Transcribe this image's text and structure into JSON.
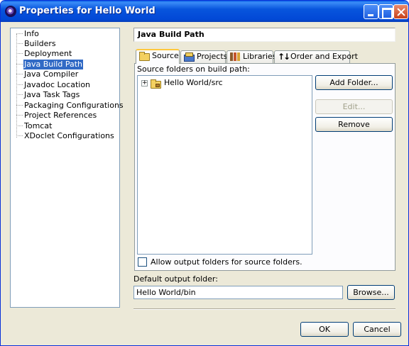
{
  "window": {
    "title": "Properties for Hello World"
  },
  "sidebar": {
    "items": [
      {
        "label": "Info",
        "selected": false
      },
      {
        "label": "Builders",
        "selected": false
      },
      {
        "label": "Deployment",
        "selected": false
      },
      {
        "label": "Java Build Path",
        "selected": true
      },
      {
        "label": "Java Compiler",
        "selected": false
      },
      {
        "label": "Javadoc Location",
        "selected": false
      },
      {
        "label": "Java Task Tags",
        "selected": false
      },
      {
        "label": "Packaging Configurations",
        "selected": false
      },
      {
        "label": "Project References",
        "selected": false
      },
      {
        "label": "Tomcat",
        "selected": false
      },
      {
        "label": "XDoclet Configurations",
        "selected": false
      }
    ]
  },
  "page": {
    "title": "Java Build Path",
    "tabs": [
      {
        "label": "Source",
        "icon": "source-folder-icon",
        "active": true
      },
      {
        "label": "Projects",
        "icon": "projects-icon",
        "active": false
      },
      {
        "label": "Libraries",
        "icon": "libraries-icon",
        "active": false
      },
      {
        "label": "Order and Export",
        "icon": "order-icon",
        "active": false
      }
    ],
    "source_label": "Source folders on build path:",
    "source_folders": [
      {
        "label": "Hello World/src",
        "expander": "+"
      }
    ],
    "buttons": {
      "add_folder": "Add Folder...",
      "edit": "Edit...",
      "remove": "Remove"
    },
    "allow_output_label": "Allow output folders for source folders.",
    "allow_output_checked": false,
    "default_output_label": "Default output folder:",
    "default_output_value": "Hello World/bin",
    "browse": "Browse..."
  },
  "footer": {
    "ok": "OK",
    "cancel": "Cancel"
  },
  "colors": {
    "selection": "#316ac5",
    "titlebar": "#0855dd",
    "dialog_bg": "#ece9d8",
    "active_tab_accent": "#ffc83c"
  }
}
